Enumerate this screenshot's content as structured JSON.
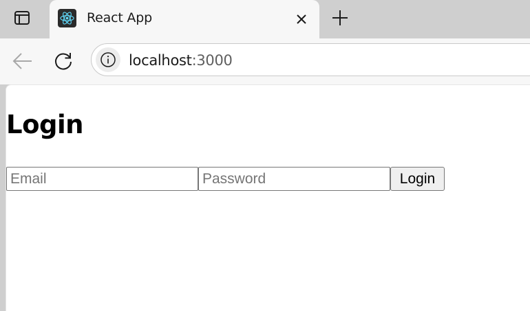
{
  "browser": {
    "tab": {
      "title": "React App",
      "favicon_icon": "react-logo-icon"
    },
    "address_bar": {
      "host": "localhost",
      "rest": ":3000"
    },
    "colors": {
      "tabstrip": "#cfcfcf",
      "toolbar": "#f7f7f7",
      "react_accent": "#61dafb"
    }
  },
  "page": {
    "heading": "Login",
    "form": {
      "email_placeholder": "Email",
      "email_value": "",
      "password_placeholder": "Password",
      "password_value": "",
      "submit_label": "Login"
    }
  }
}
